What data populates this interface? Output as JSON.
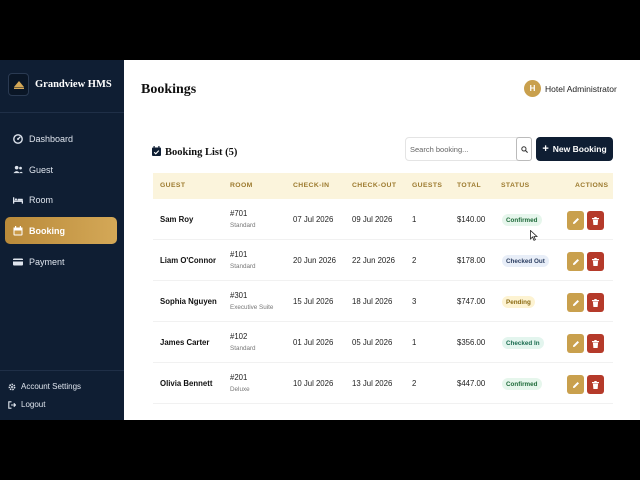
{
  "sidebar": {
    "brand": "Grandview HMS",
    "items": [
      {
        "label": "Dashboard",
        "icon": "dashboard-icon"
      },
      {
        "label": "Guest",
        "icon": "users-icon"
      },
      {
        "label": "Room",
        "icon": "bed-icon"
      },
      {
        "label": "Booking",
        "icon": "calendar-icon",
        "active": true
      },
      {
        "label": "Payment",
        "icon": "credit-card-icon"
      }
    ],
    "footer": {
      "settings": "Account Settings",
      "logout": "Logout"
    }
  },
  "header": {
    "title": "Bookings",
    "user_initial": "H",
    "user_name": "Hotel Administrator"
  },
  "list": {
    "title": "Booking List (5)",
    "search_placeholder": "Search booking...",
    "new_button": "New Booking"
  },
  "table": {
    "columns": [
      "GUEST",
      "ROOM",
      "CHECK-IN",
      "CHECK-OUT",
      "GUESTS",
      "TOTAL",
      "STATUS",
      "ACTIONS"
    ],
    "rows": [
      {
        "guest": "Sam Roy",
        "room": "#701",
        "room_type": "Standard",
        "check_in": "07 Jul 2026",
        "check_out": "09 Jul 2026",
        "guests": "1",
        "total": "$140.00",
        "status": "Confirmed"
      },
      {
        "guest": "Liam O'Connor",
        "room": "#101",
        "room_type": "Standard",
        "check_in": "20 Jun 2026",
        "check_out": "22 Jun 2026",
        "guests": "2",
        "total": "$178.00",
        "status": "Checked Out"
      },
      {
        "guest": "Sophia Nguyen",
        "room": "#301",
        "room_type": "Executive Suite",
        "check_in": "15 Jul 2026",
        "check_out": "18 Jul 2026",
        "guests": "3",
        "total": "$747.00",
        "status": "Pending"
      },
      {
        "guest": "James Carter",
        "room": "#102",
        "room_type": "Standard",
        "check_in": "01 Jul 2026",
        "check_out": "05 Jul 2026",
        "guests": "1",
        "total": "$356.00",
        "status": "Checked In"
      },
      {
        "guest": "Olivia Bennett",
        "room": "#201",
        "room_type": "Deluxe",
        "check_in": "10 Jul 2026",
        "check_out": "13 Jul 2026",
        "guests": "2",
        "total": "$447.00",
        "status": "Confirmed"
      }
    ]
  },
  "colors": {
    "sidebar_bg": "#0f1e33",
    "accent_gold": "#c9a04d",
    "delete_red": "#b53a2a"
  }
}
